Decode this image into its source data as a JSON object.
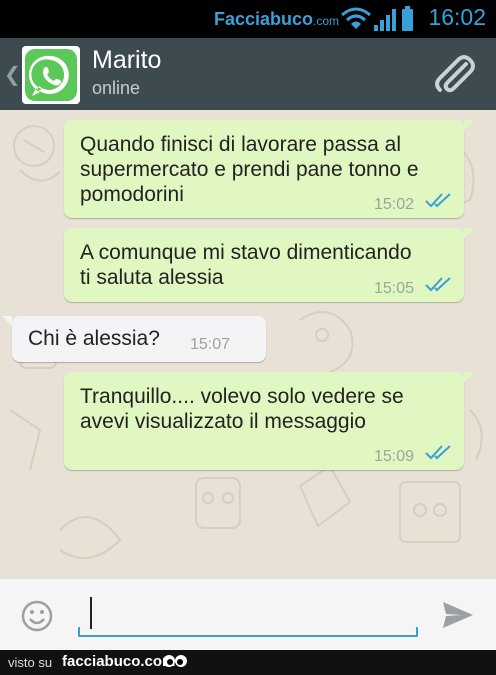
{
  "status_bar": {
    "watermark_main": "Facciabuco",
    "watermark_suffix": ".com",
    "time": "16:02",
    "icons": [
      "wifi-icon",
      "signal-icon",
      "battery-icon"
    ]
  },
  "header": {
    "contact_name": "Marito",
    "contact_status": "online",
    "icons": [
      "back-icon",
      "whatsapp-avatar-icon",
      "paperclip-icon"
    ]
  },
  "messages": [
    {
      "direction": "outgoing",
      "lines": [
        "Quando finisci di lavorare passa al",
        "supermercato e prendi pane tonno e",
        "pomodorini"
      ],
      "time": "15:02",
      "status": "read"
    },
    {
      "direction": "outgoing",
      "lines": [
        "A comunque mi stavo dimenticando",
        "ti saluta alessia"
      ],
      "time": "15:05",
      "status": "read"
    },
    {
      "direction": "incoming",
      "lines": [
        "Chi è alessia?"
      ],
      "time": "15:07"
    },
    {
      "direction": "outgoing",
      "lines": [
        "Tranquillo.... volevo solo vedere se",
        "avevi visualizzato il messaggio"
      ],
      "time": "15:09",
      "status": "read"
    }
  ],
  "input_bar": {
    "value": "",
    "icons": [
      "emoji-icon",
      "send-icon"
    ]
  },
  "footer": {
    "prefix": "visto su",
    "brand": "facciabuco.com"
  },
  "colors": {
    "header": "#3d4a50",
    "outgoing_bubble": "#e1f7c2",
    "incoming_bubble": "#f4f4f6",
    "read_ticks": "#3aa0d8",
    "accent": "#3aa0d8"
  }
}
